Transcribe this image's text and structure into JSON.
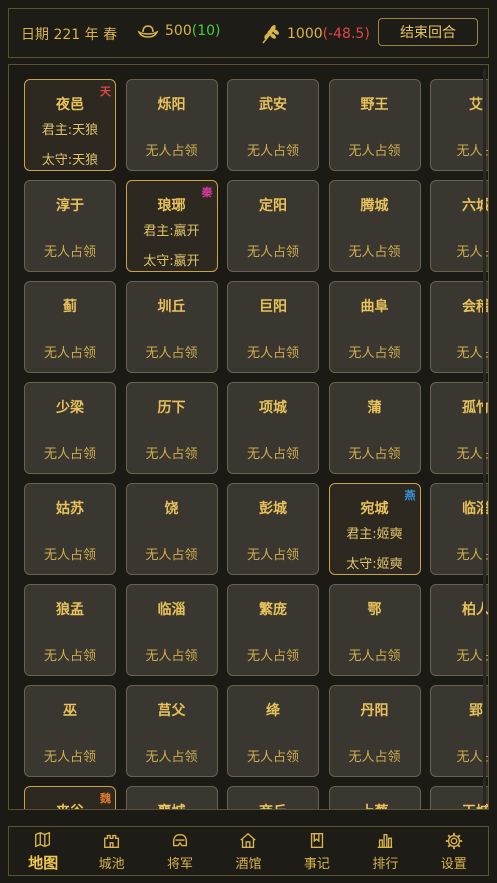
{
  "topbar": {
    "date_label": "日期",
    "year": "221",
    "year_unit": "年",
    "season": "春",
    "gold": "500",
    "gold_change": "(10)",
    "food": "1000",
    "food_change": "(-48.5)",
    "end_turn": "结束回合"
  },
  "cities": [
    {
      "row": 0,
      "col": 0,
      "name": "夜邑",
      "owned": true,
      "badge": "天",
      "badge_color": "#e14646",
      "lord": "君主:天狼",
      "governor": "太守:天狼"
    },
    {
      "row": 0,
      "col": 1,
      "name": "烁阳",
      "status": "无人占领"
    },
    {
      "row": 0,
      "col": 2,
      "name": "武安",
      "status": "无人占领"
    },
    {
      "row": 0,
      "col": 3,
      "name": "野王",
      "status": "无人占领"
    },
    {
      "row": 0,
      "col": 4,
      "name": "艾",
      "status": "无人占"
    },
    {
      "row": 1,
      "col": 0,
      "name": "淳于",
      "status": "无人占领"
    },
    {
      "row": 1,
      "col": 1,
      "name": "琅琊",
      "owned": true,
      "badge": "秦",
      "badge_color": "#d63aa0",
      "lord": "君主:嬴开",
      "governor": "太守:嬴开"
    },
    {
      "row": 1,
      "col": 2,
      "name": "定阳",
      "status": "无人占领"
    },
    {
      "row": 1,
      "col": 3,
      "name": "腾城",
      "status": "无人占领"
    },
    {
      "row": 1,
      "col": 4,
      "name": "六城",
      "status": "无人占"
    },
    {
      "row": 2,
      "col": 0,
      "name": "蓟",
      "status": "无人占领"
    },
    {
      "row": 2,
      "col": 1,
      "name": "圳丘",
      "status": "无人占领"
    },
    {
      "row": 2,
      "col": 2,
      "name": "巨阳",
      "status": "无人占领"
    },
    {
      "row": 2,
      "col": 3,
      "name": "曲阜",
      "status": "无人占领"
    },
    {
      "row": 2,
      "col": 4,
      "name": "会稽",
      "status": "无人占"
    },
    {
      "row": 3,
      "col": 0,
      "name": "少梁",
      "status": "无人占领"
    },
    {
      "row": 3,
      "col": 1,
      "name": "历下",
      "status": "无人占领"
    },
    {
      "row": 3,
      "col": 2,
      "name": "项城",
      "status": "无人占领"
    },
    {
      "row": 3,
      "col": 3,
      "name": "蒲",
      "status": "无人占领"
    },
    {
      "row": 3,
      "col": 4,
      "name": "孤竹",
      "status": "无人占"
    },
    {
      "row": 4,
      "col": 0,
      "name": "姑苏",
      "status": "无人占领"
    },
    {
      "row": 4,
      "col": 1,
      "name": "饶",
      "status": "无人占领"
    },
    {
      "row": 4,
      "col": 2,
      "name": "彭城",
      "status": "无人占领"
    },
    {
      "row": 4,
      "col": 3,
      "name": "宛城",
      "owned": true,
      "badge": "燕",
      "badge_color": "#3a8fd6",
      "lord": "君主:姬奭",
      "governor": "太守:姬奭"
    },
    {
      "row": 4,
      "col": 4,
      "name": "临淄",
      "status": "无人占"
    },
    {
      "row": 5,
      "col": 0,
      "name": "狼孟",
      "status": "无人占领"
    },
    {
      "row": 5,
      "col": 1,
      "name": "临淄",
      "status": "无人占领"
    },
    {
      "row": 5,
      "col": 2,
      "name": "繁庞",
      "status": "无人占领"
    },
    {
      "row": 5,
      "col": 3,
      "name": "鄂",
      "status": "无人占领"
    },
    {
      "row": 5,
      "col": 4,
      "name": "柏人",
      "status": "无人占"
    },
    {
      "row": 6,
      "col": 0,
      "name": "巫",
      "status": "无人占领"
    },
    {
      "row": 6,
      "col": 1,
      "name": "莒父",
      "status": "无人占领"
    },
    {
      "row": 6,
      "col": 2,
      "name": "绛",
      "status": "无人占领"
    },
    {
      "row": 6,
      "col": 3,
      "name": "丹阳",
      "status": "无人占领"
    },
    {
      "row": 6,
      "col": 4,
      "name": "郢",
      "status": "无人占"
    },
    {
      "row": 7,
      "col": 0,
      "name": "夹谷",
      "owned": true,
      "badge": "魏",
      "badge_color": "#e07a2a"
    },
    {
      "row": 7,
      "col": 1,
      "name": "襄城"
    },
    {
      "row": 7,
      "col": 2,
      "name": "商丘"
    },
    {
      "row": 7,
      "col": 3,
      "name": "上蔡"
    },
    {
      "row": 7,
      "col": 4,
      "name": "玉城"
    }
  ],
  "nav": {
    "items": [
      {
        "id": "map",
        "label": "地图",
        "icon": "map-icon",
        "active": true
      },
      {
        "id": "city",
        "label": "城池",
        "icon": "castle-icon"
      },
      {
        "id": "general",
        "label": "将军",
        "icon": "helmet-icon"
      },
      {
        "id": "tavern",
        "label": "酒馆",
        "icon": "house-icon"
      },
      {
        "id": "log",
        "label": "事记",
        "icon": "book-icon"
      },
      {
        "id": "rank",
        "label": "排行",
        "icon": "bar-chart-icon"
      },
      {
        "id": "settings",
        "label": "设置",
        "icon": "gear-icon"
      }
    ]
  },
  "colors": {
    "accent": "#d8b44a",
    "background": "#1b1a15",
    "cell": "#3a3630",
    "positive": "#3ecf3e",
    "negative": "#e14646"
  }
}
